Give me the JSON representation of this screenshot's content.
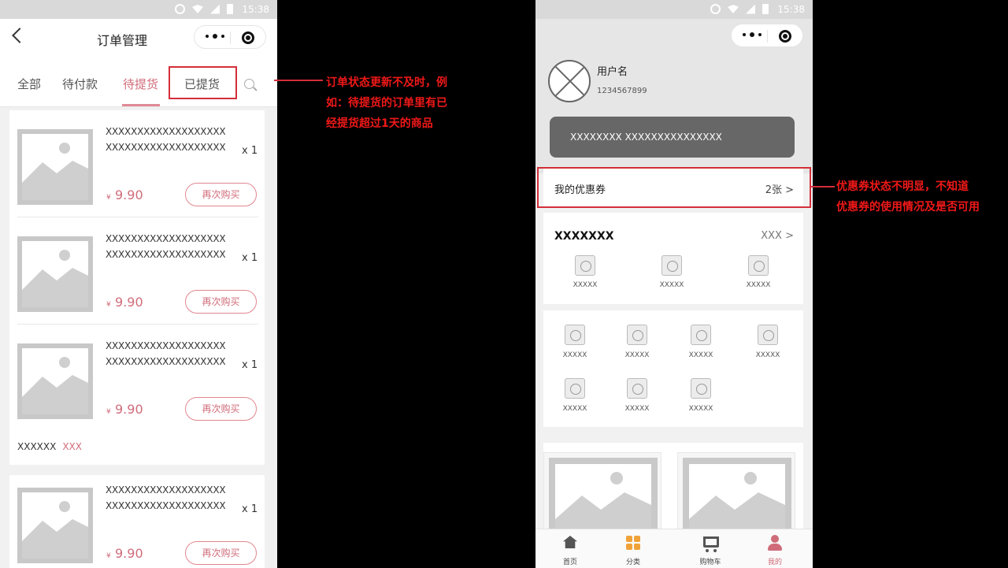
{
  "status_time": "15:38",
  "left": {
    "title": "订单管理",
    "tabs": [
      "全部",
      "待付款",
      "待提货",
      "已提货"
    ],
    "orders": [
      {
        "name1": "XXXXXXXXXXXXXXXXXXX",
        "name2": "XXXXXXXXXXXXXXXXXXX",
        "qty": "x 1",
        "currency": "¥",
        "price": "9.90",
        "rebuy": "再次购买"
      },
      {
        "name1": "XXXXXXXXXXXXXXXXXXX",
        "name2": "XXXXXXXXXXXXXXXXXXX",
        "qty": "x 1",
        "currency": "¥",
        "price": "9.90",
        "rebuy": "再次购买"
      },
      {
        "name1": "XXXXXXXXXXXXXXXXXXX",
        "name2": "XXXXXXXXXXXXXXXXXXX",
        "qty": "x 1",
        "currency": "¥",
        "price": "9.90",
        "rebuy": "再次购买"
      },
      {
        "name1": "XXXXXXXXXXXXXXXXXXX",
        "name2": "XXXXXXXXXXXXXXXXXXX",
        "qty": "x 1",
        "currency": "¥",
        "price": "9.90",
        "rebuy": "再次购买"
      }
    ],
    "card_footer": {
      "label": "XXXXXX",
      "link": "XXX"
    }
  },
  "annotation_left": [
    "订单状态更新不及时，例",
    "如：待提货的订单里有已",
    "经提货超过1天的商品"
  ],
  "right": {
    "username": "用户名",
    "user_id": "1234567899",
    "banner": "XXXXXXXX XXXXXXXXXXXXXXX",
    "coupon_label": "我的优惠券",
    "coupon_count": "2张 >",
    "section_title": "XXXXXXX",
    "section_more": "XXX >",
    "section_items": [
      "XXXXX",
      "XXXXX",
      "XXXXX"
    ],
    "grid_items": [
      "XXXXX",
      "XXXXX",
      "XXXXX",
      "XXXXX",
      "XXXXX",
      "XXXXX",
      "XXXXX"
    ],
    "tabbar": [
      "首页",
      "分类",
      "购物车",
      "我的"
    ]
  },
  "annotation_right": [
    "优惠券状态不明显，不知道",
    "优惠券的使用情况及是否可用"
  ],
  "colors": {
    "accent": "#d06c7a",
    "annotation": "#f01818",
    "highlight_box": "#d32f3a"
  }
}
